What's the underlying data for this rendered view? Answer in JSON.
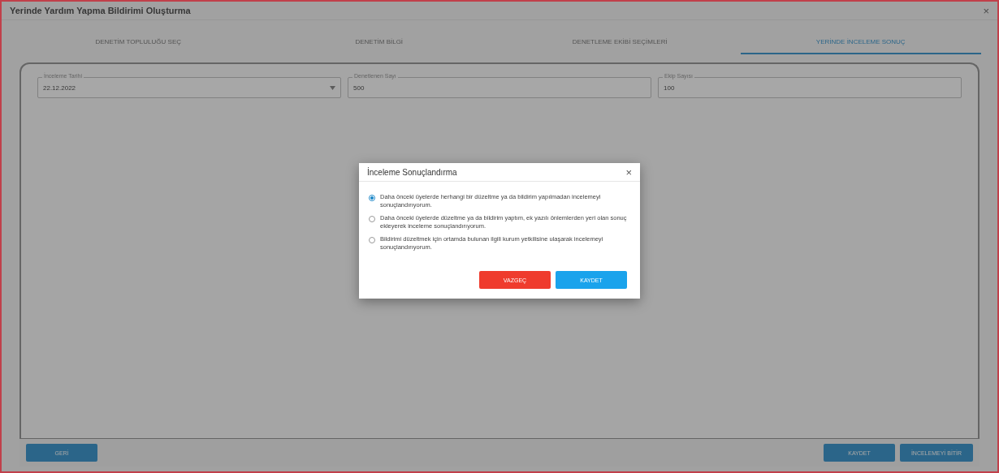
{
  "window": {
    "title": "Yerinde Yardım Yapma Bildirimi Oluşturma",
    "close": "×"
  },
  "tabs": [
    {
      "label": "DENETİM TOPLULUĞU SEÇ",
      "selected": false
    },
    {
      "label": "DENETİM BİLGİ",
      "selected": false
    },
    {
      "label": "DENETLEME EKİBİ SEÇİMLERİ",
      "selected": false
    },
    {
      "label": "YERİNDE İNCELEME SONUÇ",
      "selected": true
    }
  ],
  "fields": [
    {
      "label": "İnceleme Tarihi",
      "value": "22.12.2022",
      "kind": "select"
    },
    {
      "label": "Denetlenen Sayı",
      "value": "500",
      "kind": "text"
    },
    {
      "label": "Ekip Sayısı",
      "value": "100",
      "kind": "text"
    }
  ],
  "footer": {
    "left_buttons": [
      "GERİ"
    ],
    "right_buttons": [
      "KAYDET",
      "İNCELEMEYİ BİTİR"
    ]
  },
  "dialog": {
    "title": "İnceleme Sonuçlandırma",
    "close": "×",
    "options": [
      {
        "text": "Daha önceki üyelerde herhangi bir düzeltme ya da bildirim yapılmadan incelemeyi sonuçlandırıyorum.",
        "selected": true
      },
      {
        "text": "Daha önceki üyelerde düzeltme ya da bildirim yaptım, ek yazılı önlemlerden yeri olan sonuç ekleyerek inceleme sonuçlandırıyorum.",
        "selected": false
      },
      {
        "text": "Bildirimi düzeltmek için ortamda bulunan ilgili kurum yetkilisine ulaşarak incelemeyi sonuçlandırıyorum.",
        "selected": false
      }
    ],
    "cancel": "VAZGEÇ",
    "confirm": "KAYDET"
  }
}
